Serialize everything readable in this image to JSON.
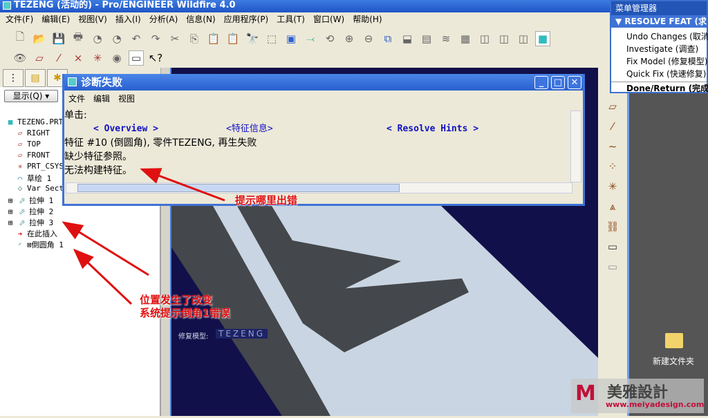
{
  "window": {
    "title": "TEZENG (活动的) - Pro/ENGINEER Wildfire 4.0"
  },
  "menu": [
    "文件(F)",
    "编辑(E)",
    "视图(V)",
    "插入(I)",
    "分析(A)",
    "信息(N)",
    "应用程序(P)",
    "工具(T)",
    "窗口(W)",
    "帮助(H)"
  ],
  "left": {
    "show_button": "显示(Q) ▾",
    "tree": [
      "TEZENG.PRT",
      "RIGHT",
      "TOP",
      "FRONT",
      "PRT_CSYS",
      "草绘 1",
      "Var Sect",
      "拉伸 1",
      "拉伸 2",
      "拉伸 3",
      "在此插入",
      "⊠倒圆角 1"
    ]
  },
  "menu_manager": {
    "title": "菜单管理器",
    "section": "▼ RESOLVE FEAT (求解特征)",
    "items": [
      "Undo Changes (取消更改)",
      "Investigate (调查)",
      "Fix Model (修复模型)",
      "Quick Fix (快速修复)"
    ],
    "done": "Done/Return (完成/返回)"
  },
  "dialog": {
    "title": "诊断失败",
    "menu": [
      "文件",
      "编辑",
      "视图"
    ],
    "click_label": "单击:",
    "links": [
      "< Overview >",
      "<特征信息>",
      "< Resolve Hints >"
    ],
    "lines": [
      "特征 #10 (倒圆角), 零件TEZENG,  再生失败",
      "缺少特征参照。",
      "无法构建特征。"
    ]
  },
  "graphics": {
    "status_label": "修复模型:",
    "status_value": "TEZENG"
  },
  "annotations": {
    "a1": "提示哪里出错",
    "a2_line1": "位置发生了改变",
    "a2_line2": "系统提示倒角1错误"
  },
  "desktop": {
    "folder_label": "新建文件夹",
    "watermark": "美雅設計",
    "watermark_url": "www.meiyadesign.com"
  }
}
